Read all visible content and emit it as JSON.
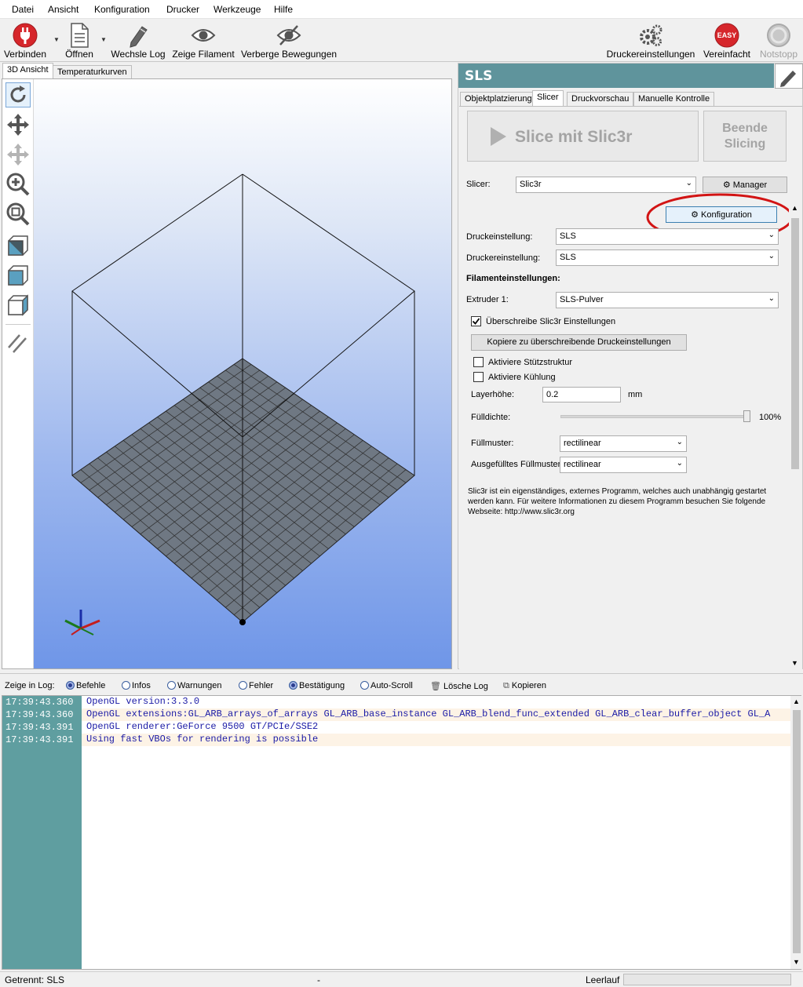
{
  "menu": [
    "Datei",
    "Ansicht",
    "Konfiguration",
    "Drucker",
    "Werkzeuge",
    "Hilfe"
  ],
  "toolbar": {
    "connect": "Verbinden",
    "open": "Öffnen",
    "change_log": "Wechsle Log",
    "show_filament": "Zeige Filament",
    "hide_moves": "Verberge Bewegungen",
    "printer_settings": "Druckereinstellungen",
    "simplified": "Vereinfacht",
    "simplified_badge": "EASY",
    "emergency_stop": "Notstopp"
  },
  "left_tabs": [
    "3D Ansicht",
    "Temperaturkurven"
  ],
  "right_panel": {
    "title": "SLS",
    "tabs": [
      "Objektplatzierung",
      "Slicer",
      "Druckvorschau",
      "Manuelle Kontrolle"
    ],
    "slice_button": "Slice mit Slic3r",
    "stop_slicing_line1": "Beende",
    "stop_slicing_line2": "Slicing",
    "slicer_label": "Slicer:",
    "slicer_value": "Slic3r",
    "manager_button": "Manager",
    "config_button": "Konfiguration",
    "print_setting_label": "Druckeinstellung:",
    "print_setting_value": "SLS",
    "printer_setting_label": "Druckereinstellung:",
    "printer_setting_value": "SLS",
    "filament_heading": "Filamenteinstellungen:",
    "extruder_label": "Extruder 1:",
    "extruder_value": "SLS-Pulver",
    "override_label": "Überschreibe Slic3r Einstellungen",
    "copy_button": "Kopiere zu überschreibende Druckeinstellungen",
    "support_label": "Aktiviere Stützstruktur",
    "cooling_label": "Aktiviere Kühlung",
    "layer_height_label": "Layerhöhe:",
    "layer_height_value": "0.2",
    "layer_height_unit": "mm",
    "infill_label": "Fülldichte:",
    "infill_value": "100%",
    "infill_fraction": 1.0,
    "fill_pattern_label": "Füllmuster:",
    "fill_pattern_value": "rectilinear",
    "solid_fill_label": "Ausgefülltes Füllmuster:",
    "solid_fill_value": "rectilinear",
    "info_line1": "Slic3r ist ein eigenständiges, externes Programm, welches auch unabhängig gestartet",
    "info_line2": "werden kann. Für weitere Informationen zu diesem Programm besuchen Sie folgende",
    "info_line3": "Webseite: http://www.slic3r.org"
  },
  "log_bar": {
    "show_label": "Zeige in Log:",
    "commands": "Befehle",
    "infos": "Infos",
    "warnings": "Warnungen",
    "errors": "Fehler",
    "ack": "Bestätigung",
    "autoscroll": "Auto-Scroll",
    "clear": "Lösche Log",
    "copy": "Kopieren"
  },
  "log": [
    {
      "time": "17:39:43.360",
      "text": "OpenGL version:3.3.0"
    },
    {
      "time": "17:39:43.360",
      "text": "OpenGL extensions:GL_ARB_arrays_of_arrays GL_ARB_base_instance GL_ARB_blend_func_extended GL_ARB_clear_buffer_object GL_A"
    },
    {
      "time": "17:39:43.391",
      "text": "OpenGL renderer:GeForce 9500 GT/PCIe/SSE2"
    },
    {
      "time": "17:39:43.391",
      "text": "Using fast VBOs for rendering is possible"
    }
  ],
  "status": {
    "connection": "Getrennt: SLS",
    "middle": "-",
    "state": "Leerlauf"
  }
}
